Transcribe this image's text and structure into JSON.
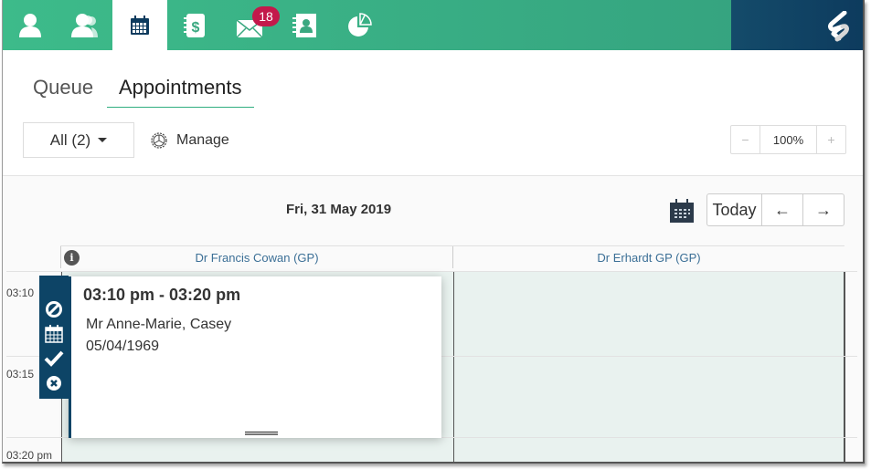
{
  "topnav": {
    "items": [
      {
        "icon": "patient-icon",
        "label": "Patient"
      },
      {
        "icon": "patients-group-icon",
        "label": "Patients"
      },
      {
        "icon": "calendar-icon",
        "label": "Calendar",
        "active": true
      },
      {
        "icon": "billing-book-icon",
        "label": "Billing"
      },
      {
        "icon": "mail-icon",
        "label": "Messages",
        "badge": "18"
      },
      {
        "icon": "address-book-icon",
        "label": "Contacts"
      },
      {
        "icon": "pie-chart-icon",
        "label": "Reports"
      }
    ],
    "brand_icon": "brand-logo-icon"
  },
  "tabs": {
    "queue": "Queue",
    "appointments": "Appointments",
    "active": "Appointments"
  },
  "toolbar": {
    "filter_label": "All (2)",
    "manage_label": "Manage",
    "zoom_minus": "−",
    "zoom_value": "100%",
    "zoom_plus": "+"
  },
  "calendar": {
    "date": "Fri, 31 May 2019",
    "today_label": "Today",
    "prev_label": "←",
    "next_label": "→",
    "columns": [
      {
        "label": "Dr Francis Cowan (GP)"
      },
      {
        "label": "Dr Erhardt GP (GP)"
      }
    ],
    "info_icon_text": "i",
    "time_labels": [
      "03:10",
      "03:15",
      "03:20 pm"
    ]
  },
  "appointment": {
    "time": "03:10 pm - 03:20 pm",
    "patient": "Mr Anne-Marie, Casey",
    "dob": "05/04/1969",
    "actions": [
      "cancel",
      "reschedule",
      "arrived",
      "delete"
    ]
  },
  "colors": {
    "nav_green": "#3dbb8a",
    "brand_navy": "#0d3b5e",
    "badge_red": "#c3194b",
    "appointment_accent": "#0d4466",
    "column_bg": "#e9f2ef",
    "link_blue": "#3b6f96"
  }
}
